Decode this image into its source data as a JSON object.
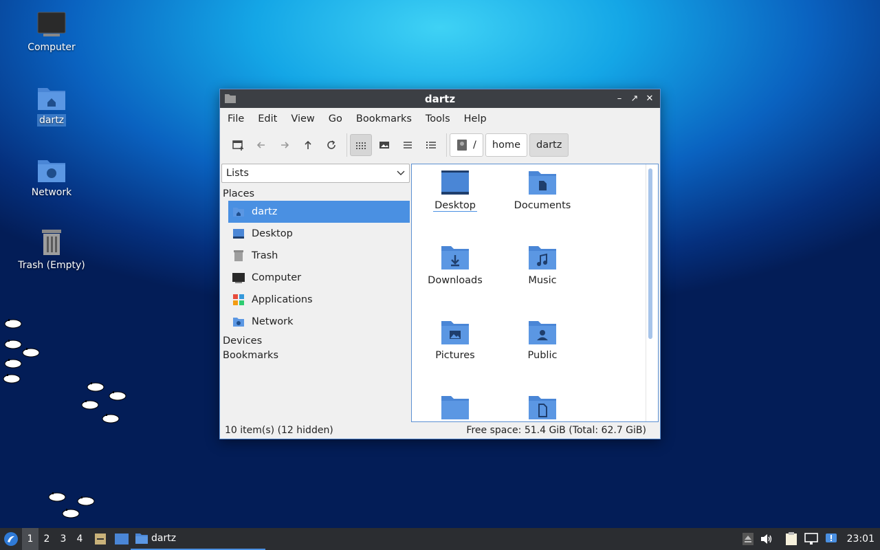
{
  "desktop": {
    "icons": [
      {
        "label": "Computer"
      },
      {
        "label": "dartz"
      },
      {
        "label": "Network"
      },
      {
        "label": "Trash (Empty)"
      }
    ]
  },
  "window": {
    "title": "dartz",
    "menu": [
      "File",
      "Edit",
      "View",
      "Go",
      "Bookmarks",
      "Tools",
      "Help"
    ],
    "path": [
      "/",
      "home",
      "dartz"
    ],
    "side_pane": {
      "mode": "Lists",
      "places_heading": "Places",
      "places": [
        "dartz",
        "Desktop",
        "Trash",
        "Computer",
        "Applications",
        "Network"
      ],
      "devices_heading": "Devices",
      "bookmarks_heading": "Bookmarks"
    },
    "files": [
      "Desktop",
      "Documents",
      "Downloads",
      "Music",
      "Pictures",
      "Public"
    ],
    "status": {
      "items": "10 item(s) (12 hidden)",
      "free_space": "Free space: 51.4 GiB (Total: 62.7 GiB)"
    }
  },
  "taskbar": {
    "workspaces": [
      "1",
      "2",
      "3",
      "4"
    ],
    "task_label": "dartz",
    "clock": "23:01"
  },
  "colors": {
    "accent": "#4a90e2",
    "folder": "#4a86d6",
    "folder_dark": "#1f4e8c",
    "titlebar": "#3c3f44",
    "taskbar": "#2b2d31"
  }
}
